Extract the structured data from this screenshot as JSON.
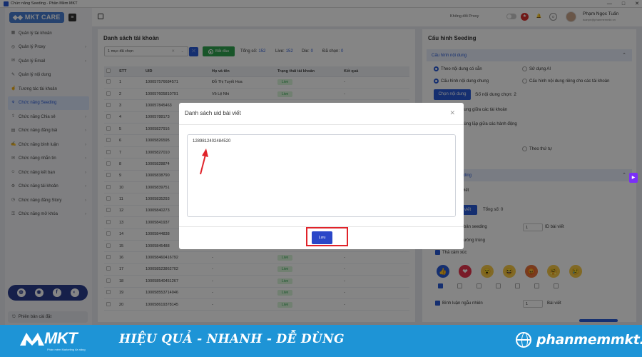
{
  "window": {
    "title": "Chức năng Seeding - Phần Mềm MKT",
    "controls": [
      "—",
      "□",
      "✕"
    ]
  },
  "brand": {
    "mark": "◆◆",
    "name": "MKT CARE"
  },
  "sidebar": {
    "items": [
      {
        "label": "Quản lý tài khoản",
        "icon": "grid-icon",
        "glyph": "▦",
        "chevron": false,
        "active": false
      },
      {
        "label": "Quản lý Proxy",
        "icon": "proxy-icon",
        "glyph": "◎",
        "chevron": true,
        "active": false
      },
      {
        "label": "Quản lý Email",
        "icon": "email-icon",
        "glyph": "✉",
        "chevron": true,
        "active": false
      },
      {
        "label": "Quản lý nội dung",
        "icon": "content-icon",
        "glyph": "✎",
        "chevron": false,
        "active": false
      },
      {
        "label": "Tương tác tài khoản",
        "icon": "interact-icon",
        "glyph": "☝",
        "chevron": false,
        "active": false
      },
      {
        "label": "Chức năng Seeding",
        "icon": "seeding-icon",
        "glyph": "⚘",
        "chevron": false,
        "active": true
      },
      {
        "label": "Chức năng Chia sẻ",
        "icon": "share-icon",
        "glyph": "⇪",
        "chevron": true,
        "active": false
      },
      {
        "label": "Chức năng đăng bài",
        "icon": "post-icon",
        "glyph": "▤",
        "chevron": true,
        "active": false
      },
      {
        "label": "Chức năng bình luận",
        "icon": "comment-icon",
        "glyph": "✍",
        "chevron": true,
        "active": false
      },
      {
        "label": "Chức năng nhắn tin",
        "icon": "message-icon",
        "glyph": "✉",
        "chevron": true,
        "active": false
      },
      {
        "label": "Chức năng kết bạn",
        "icon": "friend-icon",
        "glyph": "☺",
        "chevron": true,
        "active": false
      },
      {
        "label": "Chức năng tài khoản",
        "icon": "account-icon",
        "glyph": "⚙",
        "chevron": true,
        "active": false
      },
      {
        "label": "Chức năng đăng Story",
        "icon": "story-icon",
        "glyph": "◷",
        "chevron": true,
        "active": false
      },
      {
        "label": "Chức năng mở khóa",
        "icon": "unlock-icon",
        "glyph": "⚿",
        "chevron": true,
        "active": false
      }
    ],
    "social": [
      "◍",
      "◉",
      "f",
      "◐"
    ],
    "version_label": "Phiên bản cài đặt"
  },
  "topbar": {
    "proxy_label": "Không đổi Proxy",
    "user_name": "Phạm Ngọc Tuấn",
    "user_email": "tuanpn@phanmemmkt.vn"
  },
  "accounts": {
    "title": "Danh sách tài khoản",
    "filter_value": "1 mục đã chọn",
    "clear_glyph": "✕",
    "dropdown_glyph": "⌄",
    "start_label": "Bắt đầu",
    "stats": {
      "total_label": "Tổng số:",
      "total": "152",
      "live_label": "Live:",
      "live": "152",
      "die_label": "Die:",
      "die": "0",
      "selected_label": "Đã chọn:",
      "selected": "0"
    },
    "columns": [
      "STT",
      "UID",
      "Họ và tên",
      "Trạng thái tài khoản",
      "Kết quả"
    ],
    "rows": [
      {
        "stt": "1",
        "uid": "100057576684571",
        "name": "Đỗ Thị Tuyết Hoa",
        "status": "Live",
        "result": "-"
      },
      {
        "stt": "2",
        "uid": "100057605810791",
        "name": "Võ Lệ Nhi",
        "status": "Live",
        "result": "-"
      },
      {
        "stt": "3",
        "uid": "100057845463",
        "name": "",
        "status": "",
        "result": ""
      },
      {
        "stt": "4",
        "uid": "10005788173",
        "name": "",
        "status": "",
        "result": ""
      },
      {
        "stt": "5",
        "uid": "10005827916",
        "name": "",
        "status": "",
        "result": ""
      },
      {
        "stt": "6",
        "uid": "10005826595",
        "name": "",
        "status": "",
        "result": ""
      },
      {
        "stt": "7",
        "uid": "10005827010",
        "name": "",
        "status": "",
        "result": ""
      },
      {
        "stt": "8",
        "uid": "10005828874",
        "name": "",
        "status": "",
        "result": ""
      },
      {
        "stt": "9",
        "uid": "10005838790",
        "name": "",
        "status": "",
        "result": ""
      },
      {
        "stt": "10",
        "uid": "10005839751",
        "name": "",
        "status": "",
        "result": ""
      },
      {
        "stt": "11",
        "uid": "10005835293",
        "name": "",
        "status": "",
        "result": ""
      },
      {
        "stt": "12",
        "uid": "10005840273",
        "name": "",
        "status": "",
        "result": ""
      },
      {
        "stt": "13",
        "uid": "10005841937",
        "name": "",
        "status": "",
        "result": ""
      },
      {
        "stt": "14",
        "uid": "10005844838",
        "name": "",
        "status": "",
        "result": ""
      },
      {
        "stt": "15",
        "uid": "10005845488",
        "name": "",
        "status": "",
        "result": ""
      },
      {
        "stt": "16",
        "uid": "100058460416792",
        "name": "-",
        "status": "Live",
        "result": "-"
      },
      {
        "stt": "17",
        "uid": "100058523862702",
        "name": "-",
        "status": "Live",
        "result": "-"
      },
      {
        "stt": "18",
        "uid": "100058540451267",
        "name": "-",
        "status": "Live",
        "result": "-"
      },
      {
        "stt": "19",
        "uid": "100058553714046",
        "name": "-",
        "status": "Live",
        "result": "-"
      },
      {
        "stt": "20",
        "uid": "100058619378145",
        "name": "-",
        "status": "Live",
        "result": "-"
      }
    ]
  },
  "seeding": {
    "title": "Cấu hình Seeding",
    "content_section": "Cấu hình nội dung",
    "radio_default": "Theo nội dung có sẵn",
    "radio_ai": "Sử dụng AI",
    "radio_common": "Cấu hình nội dung chung",
    "radio_separate": "Cấu hình nội dung riêng cho các tài khoản",
    "choose_content": "Chọn nội dung",
    "content_count": "Số nội dung chọn: 2",
    "opt_dup_accounts": "trùng nội dung giữa các tài khoản",
    "opt_dup_actions": "nội dung trùng lặp giữa các hành động",
    "opt_fragment": "n",
    "radio_order": "Theo thứ tự",
    "section2": "eeding",
    "posts_label": "viết",
    "select_posts": "viết",
    "total_posts": "Tổng số: 0",
    "per_seeding": "bản seeding",
    "per_value": "1",
    "posts_unit": "ID bài viết",
    "dup_label": "ường trùng",
    "emotion_label": "Thả cảm xúc",
    "emojis": [
      "👍",
      "❤",
      "😮",
      "😆",
      "😡",
      "🤗",
      "😢"
    ],
    "emoji_checks": [
      true,
      false,
      false,
      false,
      false,
      false,
      false
    ],
    "random_comment": "Bình luận ngẫu nhiên",
    "comment_value": "1",
    "comment_unit": "Bài viết"
  },
  "modal": {
    "title": "Danh sách uid bài viết",
    "close_glyph": "✕",
    "uid_value": "1289812402484520",
    "save_label": "Lưu"
  },
  "banner": {
    "brand": "MKT",
    "subtitle": "Phần mềm Marketing đa năng",
    "slogan": "HIỆU QUẢ - NHANH - DỄ DÙNG",
    "site": "phanmemmkt.vn"
  },
  "colors": {
    "accent": "#2a5bd7",
    "success": "#2ea44f",
    "banner": "#1e94d6",
    "highlight": "#e0232a"
  }
}
